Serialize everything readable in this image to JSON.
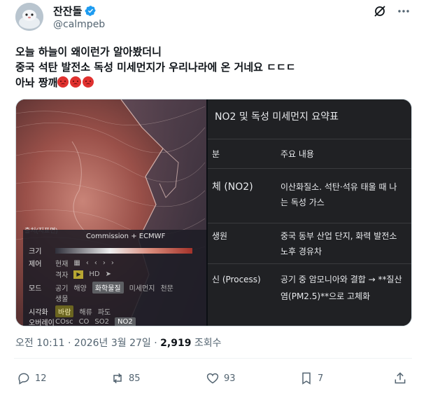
{
  "author": {
    "name": "잔잔돌",
    "handle": "@calmpeb"
  },
  "tweet": {
    "lines": [
      "오늘 하늘이 왜이런가 알아봤더니",
      "중국 석탄 발전소 독성 미세먼지가 우리나라에 온 거네요 ㄷㄷㄷ",
      "아놔 짱깨"
    ]
  },
  "media_left": {
    "panel_top_label": "출처(지표면)",
    "source": "Commission + ECMWF",
    "rows": {
      "size_label": "크기",
      "control_label": "제어",
      "control_now": "현재",
      "control_grid": "격자",
      "control_hd": "HD",
      "mode_label": "모드",
      "mode_options": [
        "공기",
        "해양",
        "화학물질",
        "미세먼지",
        "천문"
      ],
      "mode_selected": "화학물질",
      "mode_extra": "생물",
      "visual_label": "시각화",
      "visual_options": [
        "바람",
        "해류",
        "파도"
      ],
      "visual_selected": "바람",
      "overlay_label": "오버레이",
      "overlay_options": [
        "COsc",
        "CO",
        "SO2",
        "NO2"
      ],
      "overlay_selected": "NO2"
    }
  },
  "media_right": {
    "title": "NO2 및 독성 미세먼지 요약표",
    "header": [
      "분",
      "주요 내용"
    ],
    "rows": [
      {
        "col1": "체 (NO2)",
        "col2a": "이산화질소. 석탄·석유 태울 때 나",
        "col2b": "는 독성 가스"
      },
      {
        "col1": "생원",
        "col2a": "중국 동부 산업 단지, 화력 발전소",
        "col2b": "노후 경유차"
      },
      {
        "col1": "신 (Process)",
        "col2a": "공기 중 암모니아와 결합 → **질산",
        "col2b": "염(PM2.5)**으로 고체화"
      }
    ]
  },
  "meta": {
    "time": "오전 10:11 · 2026년 3월 27일 · ",
    "views_count": "2,919",
    "views_label": " 조회수"
  },
  "actions": {
    "replies": "12",
    "reposts": "85",
    "likes": "93",
    "bookmarks": "7"
  },
  "icons": [
    "avatar",
    "verified-badge-icon",
    "grok-icon",
    "more-icon",
    "reply-icon",
    "repost-icon",
    "like-icon",
    "bookmark-icon",
    "share-icon"
  ],
  "colors": {
    "verified": "#1d9bf0",
    "text_primary": "#0f1419",
    "text_secondary": "#536471"
  }
}
